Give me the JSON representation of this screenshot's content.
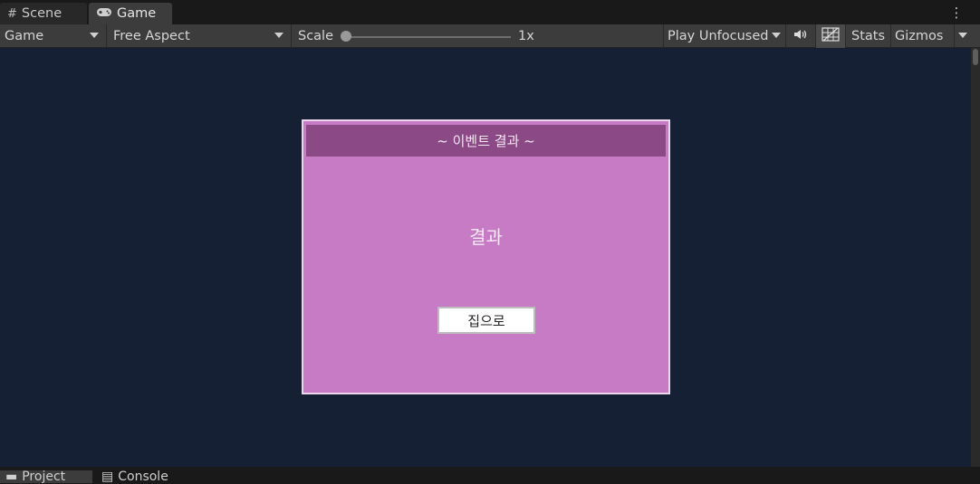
{
  "tabs": {
    "scene": {
      "label": "Scene",
      "icon": "grid-icon"
    },
    "game": {
      "label": "Game",
      "icon": "gamepad-icon"
    }
  },
  "toolbar": {
    "display": "Game",
    "aspect": "Free Aspect",
    "scale_label": "Scale",
    "scale_value": "1x",
    "scale_level": 0,
    "play_mode": "Play Unfocused",
    "stats": "Stats",
    "gizmos": "Gizmos"
  },
  "popup": {
    "title": "~ 이벤트 결과 ~",
    "body": "결과",
    "button": "집으로"
  },
  "bottom_tabs": {
    "project": "Project",
    "console": "Console"
  },
  "colors": {
    "view_bg": "#152034",
    "popup_bg": "#c67bc4",
    "popup_header": "#8b4985"
  }
}
